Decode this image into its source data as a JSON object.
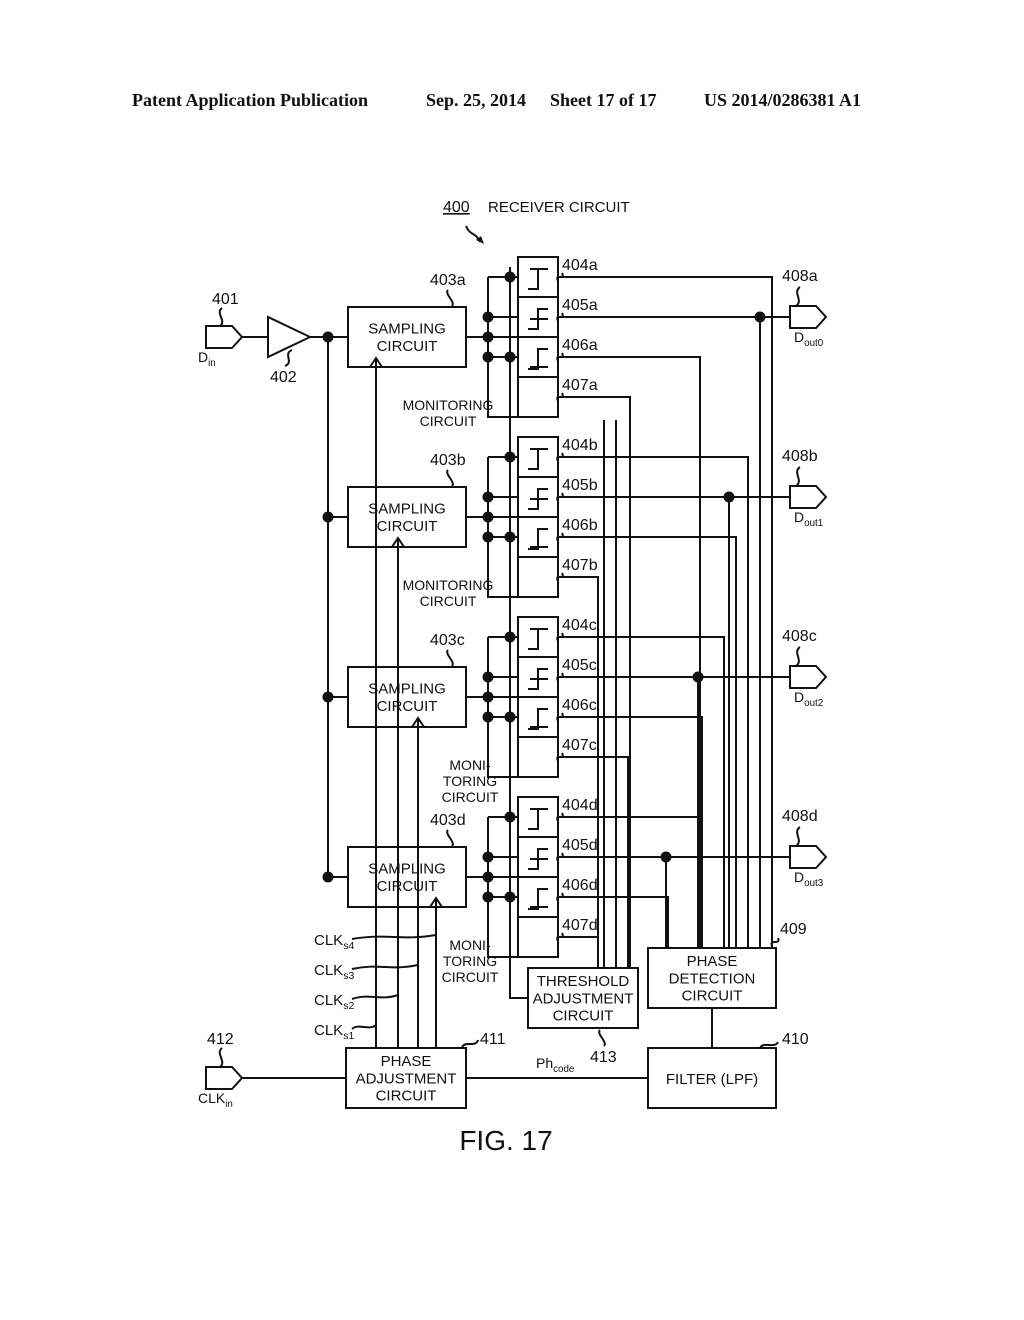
{
  "header": {
    "publication": "Patent Application Publication",
    "date": "Sep. 25, 2014",
    "sheet": "Sheet 17 of 17",
    "number": "US 2014/0286381 A1"
  },
  "figure": {
    "caption": "FIG. 17",
    "title_ref": "400",
    "title": "RECEIVER CIRCUIT",
    "input": {
      "ref": "401",
      "label": "D",
      "sub": "in"
    },
    "amplifier": {
      "ref": "402"
    },
    "lanes": [
      {
        "sampler_ref": "403a",
        "sampler": [
          "SAMPLING",
          "CIRCUIT"
        ],
        "cmp": [
          "404a",
          "405a",
          "406a"
        ],
        "mon_ref": "407a",
        "mon": [
          "MONITORING",
          "CIRCUIT"
        ],
        "out_ref": "408a",
        "out_label": "D",
        "out_sub": "out0"
      },
      {
        "sampler_ref": "403b",
        "sampler": [
          "SAMPLING",
          "CIRCUIT"
        ],
        "cmp": [
          "404b",
          "405b",
          "406b"
        ],
        "mon_ref": "407b",
        "mon": [
          "MONITORING",
          "CIRCUIT"
        ],
        "out_ref": "408b",
        "out_label": "D",
        "out_sub": "out1"
      },
      {
        "sampler_ref": "403c",
        "sampler": [
          "SAMPLING",
          "CIRCUIT"
        ],
        "cmp": [
          "404c",
          "405c",
          "406c"
        ],
        "mon_ref": "407c",
        "mon": [
          "MONI-",
          "TORING",
          "CIRCUIT"
        ],
        "out_ref": "408c",
        "out_label": "D",
        "out_sub": "out2"
      },
      {
        "sampler_ref": "403d",
        "sampler": [
          "SAMPLING",
          "CIRCUIT"
        ],
        "cmp": [
          "404d",
          "405d",
          "406d"
        ],
        "mon_ref": "407d",
        "mon": [
          "MONI-",
          "TORING",
          "CIRCUIT"
        ],
        "out_ref": "408d",
        "out_label": "D",
        "out_sub": "out3"
      }
    ],
    "clocks": [
      {
        "label": "CLK",
        "sub": "s4"
      },
      {
        "label": "CLK",
        "sub": "s3"
      },
      {
        "label": "CLK",
        "sub": "s2"
      },
      {
        "label": "CLK",
        "sub": "s1"
      }
    ],
    "phase_detection": {
      "ref": "409",
      "lines": [
        "PHASE",
        "DETECTION",
        "CIRCUIT"
      ]
    },
    "filter": {
      "ref": "410",
      "label": "FILTER (LPF)"
    },
    "phase_adjustment": {
      "ref": "411",
      "lines": [
        "PHASE",
        "ADJUSTMENT",
        "CIRCUIT"
      ]
    },
    "clock_input": {
      "ref": "412",
      "label": "CLK",
      "sub": "in"
    },
    "threshold": {
      "ref": "413",
      "lines": [
        "THRESHOLD",
        "ADJUSTMENT",
        "CIRCUIT"
      ]
    },
    "phcode": {
      "label": "Ph",
      "sub": "code"
    }
  }
}
